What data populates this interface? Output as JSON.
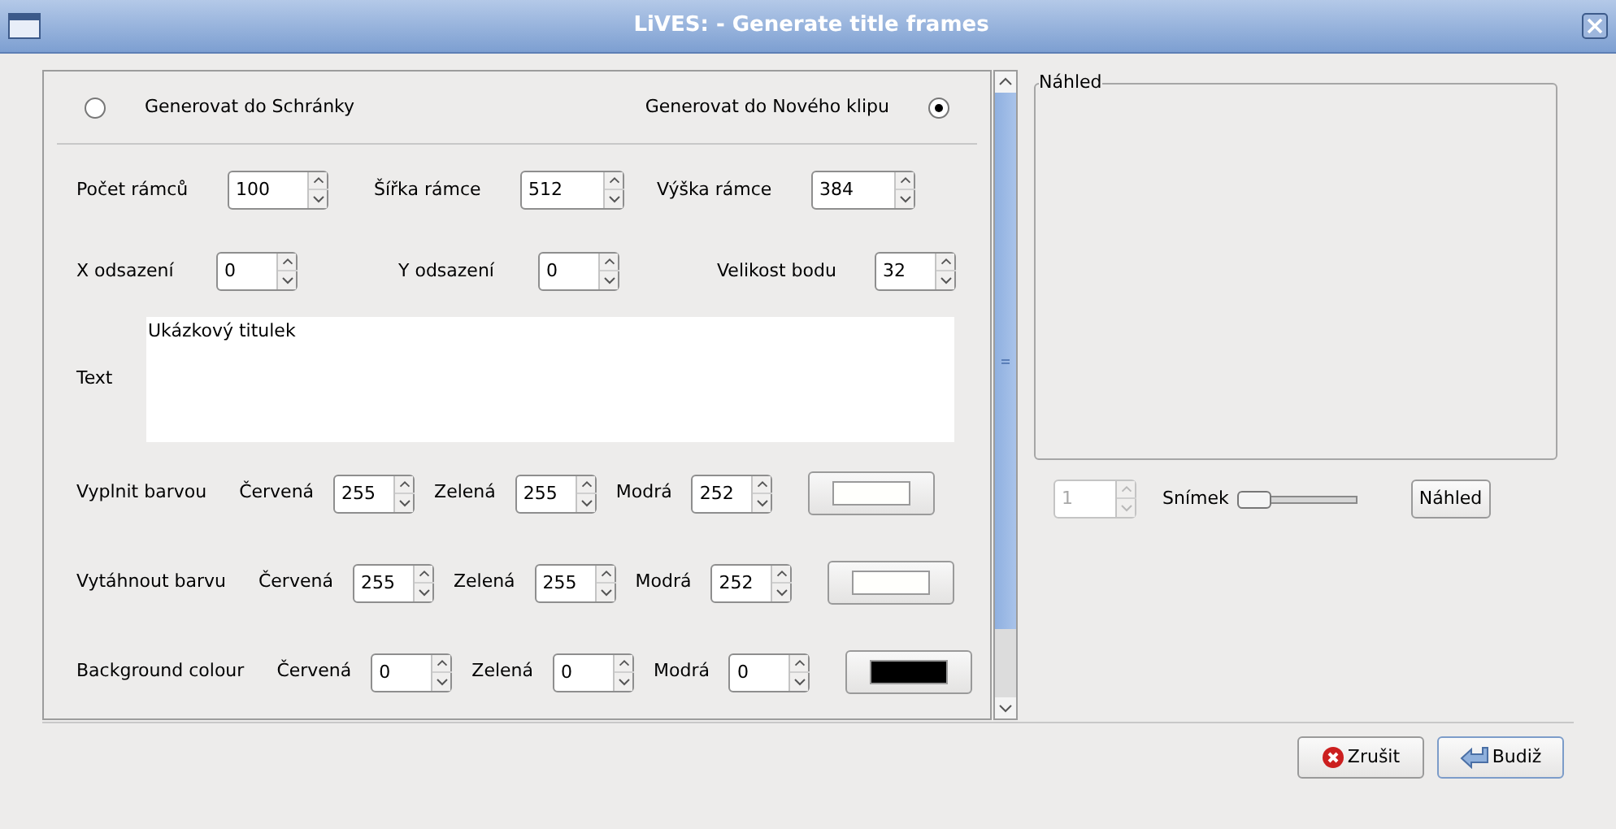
{
  "window": {
    "title": "LiVES: - Generate title frames"
  },
  "target_options": [
    {
      "label": "Generovat do Schránky",
      "selected": false
    },
    {
      "label": "Generovat do Nového klipu",
      "selected": true
    }
  ],
  "field_rows": [
    [
      {
        "label": "Počet rámců",
        "value": "100"
      },
      {
        "label": "Šířka rámce",
        "value": "512"
      },
      {
        "label": "Výška rámce",
        "value": "384"
      }
    ],
    [
      {
        "label": "X odsazení",
        "value": "0"
      },
      {
        "label": "Y odsazení",
        "value": "0"
      },
      {
        "label": "Velikost bodu",
        "value": "32"
      }
    ]
  ],
  "text": {
    "label": "Text",
    "value": "Ukázkový titulek"
  },
  "colour_rows": [
    {
      "label": "Vyplnit barvou",
      "channels": [
        {
          "label": "Červená",
          "value": "255"
        },
        {
          "label": "Zelená",
          "value": "255"
        },
        {
          "label": "Modrá",
          "value": "252"
        }
      ],
      "color": "#fffffc"
    },
    {
      "label": "Vytáhnout barvu",
      "channels": [
        {
          "label": "Červená",
          "value": "255"
        },
        {
          "label": "Zelená",
          "value": "255"
        },
        {
          "label": "Modrá",
          "value": "252"
        }
      ],
      "color": "#fffffc"
    },
    {
      "label": "Background colour",
      "channels": [
        {
          "label": "Červená",
          "value": "0"
        },
        {
          "label": "Zelená",
          "value": "0"
        },
        {
          "label": "Modrá",
          "value": "0"
        }
      ],
      "color": "#000000"
    }
  ],
  "preview": {
    "title": "Náhled",
    "frame": {
      "value": "1",
      "disabled": true
    },
    "slider": {
      "label": "Snímek",
      "level": 0
    },
    "button": "Náhled"
  },
  "buttons": [
    {
      "label": "Zrušit",
      "kind": "cancel"
    },
    {
      "label": "Budiž",
      "kind": "ok"
    }
  ]
}
